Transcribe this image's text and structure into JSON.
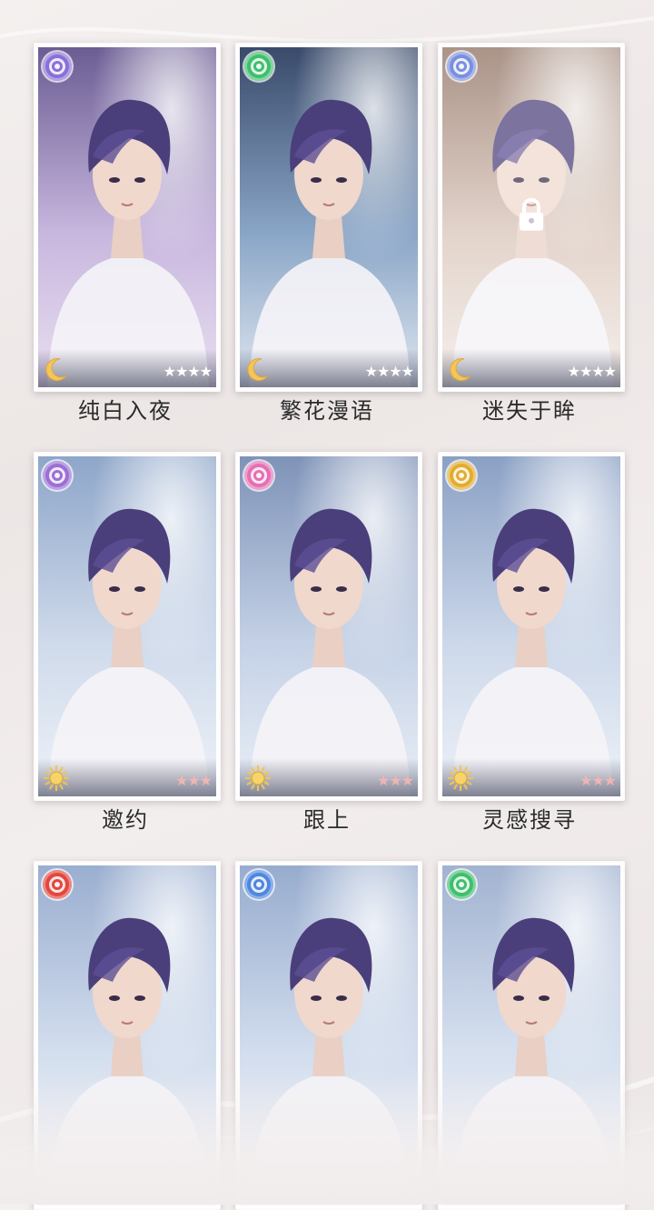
{
  "cards": [
    {
      "title": "纯白入夜",
      "attr_color": "#8a6fd8",
      "time": "moon",
      "stars": "★★★★",
      "star_color": "#ffffff",
      "locked": false,
      "palette": [
        "#6b5c93",
        "#c8b7de",
        "#e9dff0"
      ]
    },
    {
      "title": "繁花漫语",
      "attr_color": "#3fbf6d",
      "time": "moon",
      "stars": "★★★★",
      "star_color": "#ffffff",
      "locked": false,
      "palette": [
        "#394a6a",
        "#8aa6c7",
        "#dfe6ef"
      ]
    },
    {
      "title": "迷失于眸",
      "attr_color": "#7b8fe0",
      "time": "moon",
      "stars": "★★★★",
      "star_color": "#ffffff",
      "locked": true,
      "palette": [
        "#8a6a5a",
        "#d9c4b8",
        "#f1e9e4"
      ]
    },
    {
      "title": "邀约",
      "attr_color": "#9b6fd6",
      "time": "sun",
      "stars": "★★★",
      "star_color": "#f0b5b5",
      "locked": false,
      "palette": [
        "#8ea6c9",
        "#cfdaeb",
        "#eef2f8"
      ]
    },
    {
      "title": "跟上",
      "attr_color": "#e66fb4",
      "time": "sun",
      "stars": "★★★",
      "star_color": "#f0b5b5",
      "locked": false,
      "palette": [
        "#7f93b8",
        "#c4d1e6",
        "#eaeff7"
      ]
    },
    {
      "title": "灵感搜寻",
      "attr_color": "#e3ac2f",
      "time": "sun",
      "stars": "★★★",
      "star_color": "#f0b5b5",
      "locked": false,
      "palette": [
        "#8aa0c4",
        "#ccd8ea",
        "#eef2f8"
      ]
    },
    {
      "title": "",
      "attr_color": "#e2473d",
      "time": "",
      "stars": "",
      "star_color": "#ffffff",
      "locked": false,
      "palette": [
        "#9aaed0",
        "#d3deee",
        "#f0f3f8"
      ]
    },
    {
      "title": "",
      "attr_color": "#4f86e0",
      "time": "",
      "stars": "",
      "star_color": "#ffffff",
      "locked": false,
      "palette": [
        "#97acce",
        "#d2ddee",
        "#f0f3f8"
      ]
    },
    {
      "title": "",
      "attr_color": "#3fbf6d",
      "time": "",
      "stars": "",
      "star_color": "#ffffff",
      "locked": false,
      "palette": [
        "#a2b3d1",
        "#d6e0ef",
        "#f1f4f9"
      ]
    }
  ]
}
